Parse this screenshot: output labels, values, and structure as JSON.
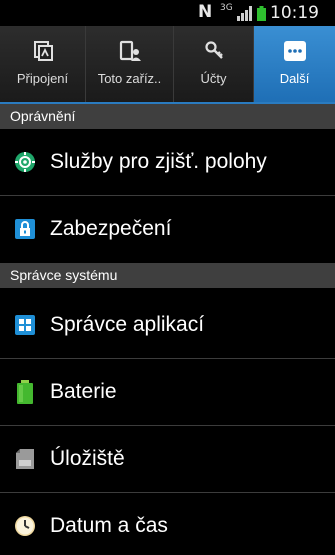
{
  "status_bar": {
    "network_letter": "N",
    "network_type": "3G",
    "time": "10:19",
    "battery_color": "#2fbf2f"
  },
  "tabs": [
    {
      "label": "Připojení",
      "icon": "connections-icon",
      "active": false
    },
    {
      "label": "Toto zaříz..",
      "icon": "device-icon",
      "active": false
    },
    {
      "label": "Účty",
      "icon": "accounts-key-icon",
      "active": false
    },
    {
      "label": "Další",
      "icon": "more-dots-icon",
      "active": true
    }
  ],
  "sections": {
    "permissions": {
      "title": "Oprávnění",
      "items": [
        {
          "label": "Služby pro zjišť. polohy",
          "icon": "location-services-icon"
        },
        {
          "label": "Zabezpečení",
          "icon": "security-lock-icon"
        }
      ]
    },
    "system_manager": {
      "title": "Správce systému",
      "items": [
        {
          "label": "Správce aplikací",
          "icon": "application-manager-icon"
        },
        {
          "label": "Baterie",
          "icon": "battery-icon"
        },
        {
          "label": "Úložiště",
          "icon": "storage-icon"
        },
        {
          "label": "Datum a čas",
          "icon": "clock-icon"
        }
      ]
    }
  },
  "colors": {
    "accent": "#2a7bc0",
    "section_header_bg": "#3f3f3f",
    "background": "#000000"
  }
}
